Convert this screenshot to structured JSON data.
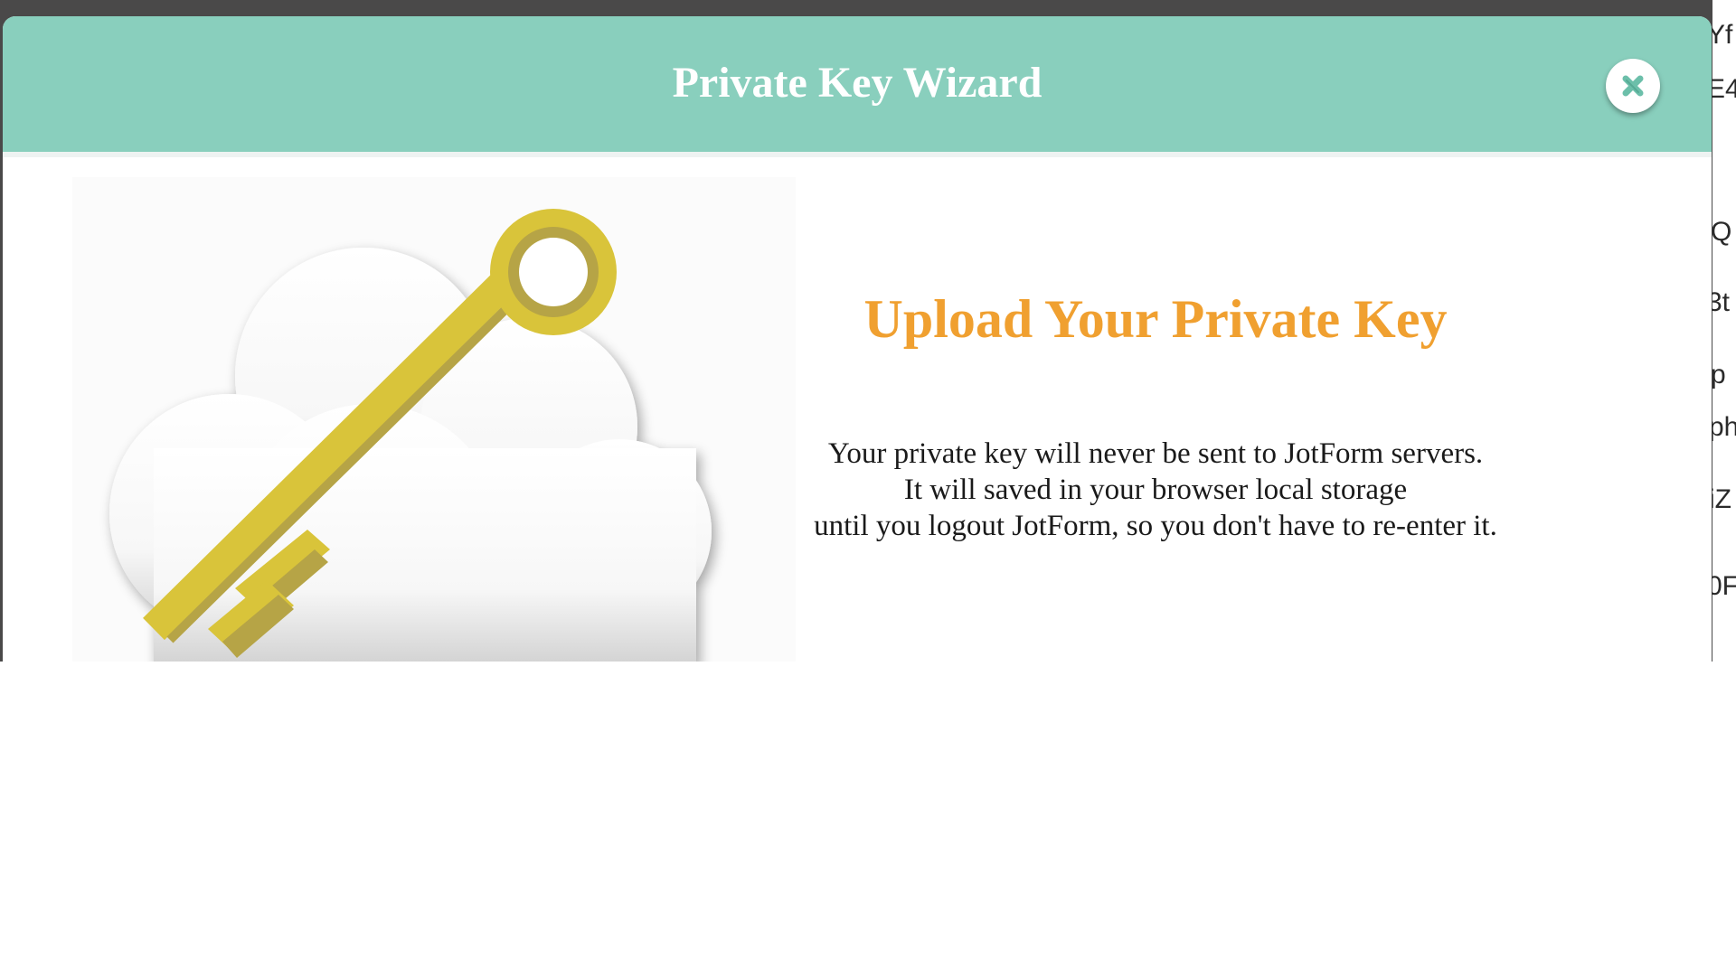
{
  "dialog": {
    "title": "Private Key Wizard",
    "close_icon": "close-icon",
    "accent_color": "#89cfbd"
  },
  "content": {
    "heading": "Upload Your Private Key",
    "heading_color": "#f0a030",
    "lines": [
      "Your private key will never be sent to JotForm servers.",
      "It will saved in your browser local storage",
      "until you logout JotForm, so you don't have to re-enter it."
    ]
  },
  "illustration": {
    "icon": "key-cloud-icon"
  },
  "background_fragments": [
    "Yf",
    "E4",
    "Q",
    "3t",
    "p",
    "ph",
    "iZ",
    "0F"
  ]
}
